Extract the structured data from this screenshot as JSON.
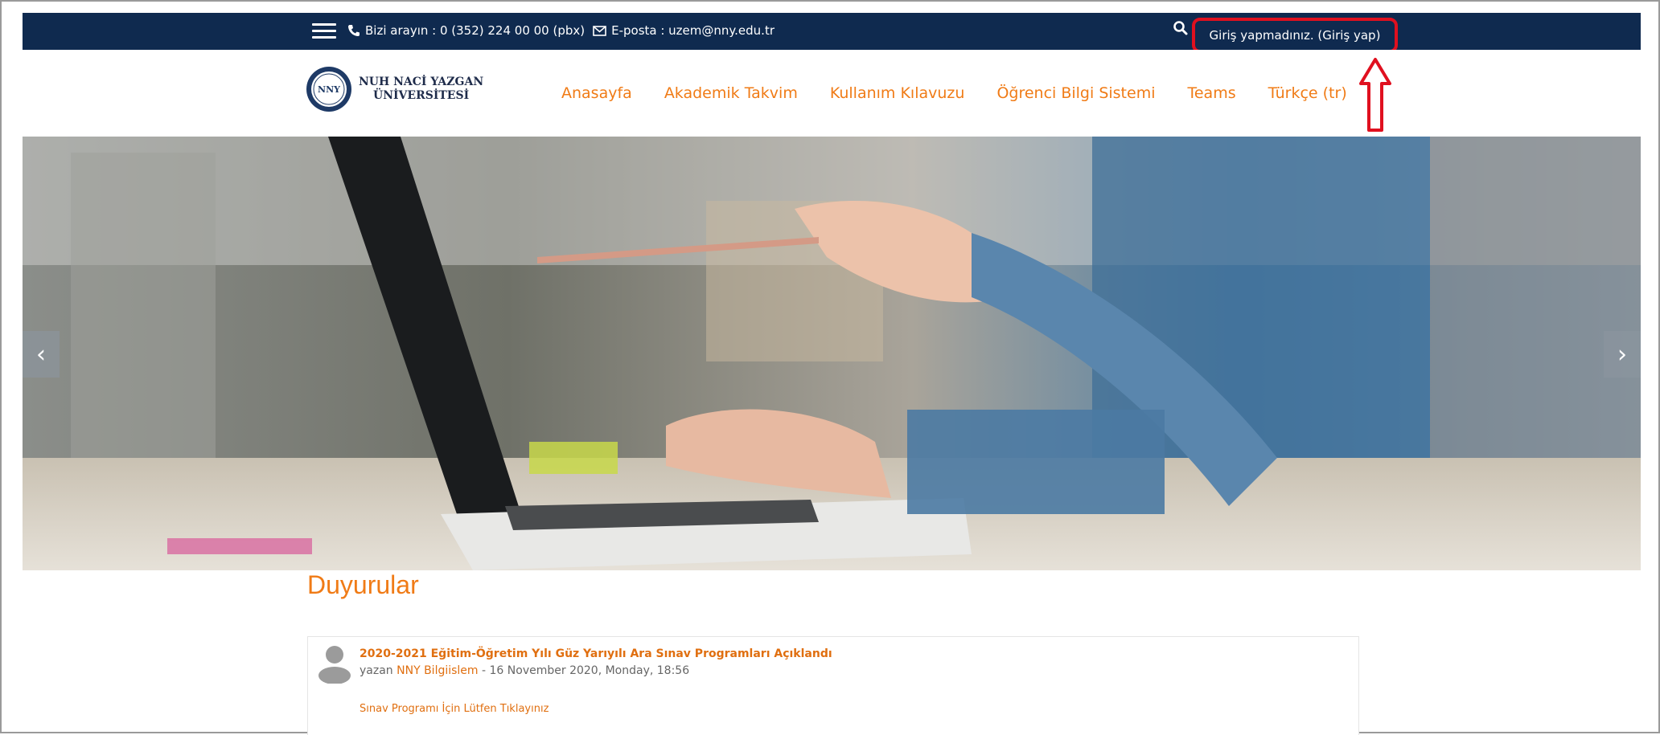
{
  "topbar": {
    "contact_phone": "Bizi arayın : 0 (352) 224 00 00 (pbx)",
    "contact_email": "E-posta : uzem@nny.edu.tr",
    "login_text": "Giriş yapmadınız. (Giriş yap)",
    "highlight_color": "#e0101f",
    "bar_color": "#0f2a4f"
  },
  "logo": {
    "seal_text": "NNY",
    "line1": "NUH NACİ YAZGAN",
    "line2": "ÜNİVERSİTESİ"
  },
  "nav": {
    "items": [
      "Anasayfa",
      "Akademik Takvim",
      "Kullanım Kılavuzu",
      "Öğrenci Bilgi Sistemi",
      "Teams",
      "Türkçe (tr)"
    ],
    "accent_color": "#f07b16"
  },
  "carousel": {
    "prev_icon": "chevron-left-icon",
    "next_icon": "chevron-right-icon",
    "prev_label": "‹",
    "next_label": "›"
  },
  "announcements": {
    "title": "Duyurular",
    "items": [
      {
        "title": "2020-2021 Eğitim-Öğretim Yılı Güz Yarıyılı Ara Sınav Programları Açıklandı",
        "by_prefix": "yazan",
        "author": "NNY Bilgiislem",
        "date": "- 16 November 2020, Monday, 18:56",
        "link": "Sınav Programı İçin Lütfen Tıklayınız"
      }
    ]
  }
}
